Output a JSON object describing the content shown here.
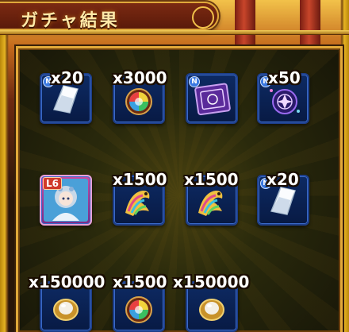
{
  "header": {
    "title": "ガチャ結果"
  },
  "new_badge": "N",
  "character_level_badge": "L6",
  "items": [
    {
      "icon": "crystal-icon",
      "count": "x20",
      "new": true
    },
    {
      "icon": "rainbow-orb-icon",
      "count": "x3000",
      "new": false
    },
    {
      "icon": "ticket-icon",
      "count": "",
      "new": true
    },
    {
      "icon": "magic-circle-icon",
      "count": "x50",
      "new": true
    },
    {
      "icon": "character-portrait",
      "count": "",
      "new": false
    },
    {
      "icon": "rainbow-dragon-icon",
      "count": "x1500",
      "new": false
    },
    {
      "icon": "rainbow-dragon-icon",
      "count": "x1500",
      "new": false
    },
    {
      "icon": "crystal-icon",
      "count": "x20",
      "new": true
    },
    {
      "icon": "gold-egg-icon",
      "count": "x150000",
      "new": false
    },
    {
      "icon": "rainbow-orb-icon",
      "count": "x1500",
      "new": false
    },
    {
      "icon": "gold-egg-icon",
      "count": "x150000",
      "new": false
    }
  ]
}
